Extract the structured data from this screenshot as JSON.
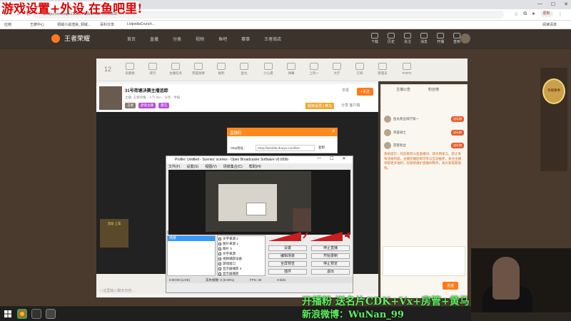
{
  "overlay": {
    "title": "游戏设置+外设,在鱼吧里!",
    "promo_line1": "开播粉 送名片CDK+Vx+房管+黄马",
    "promo_line2": "新浪微博：WuNan_99"
  },
  "browser": {
    "url": "douyu.com/topic/2019YNWE?rid=5396328",
    "profile_label": "更新",
    "bookmarks": [
      "应用",
      "王牌中心",
      "领域小说渲染_领域...",
      "百科分享",
      "LolpediaCrunch..."
    ],
    "bookmarks_right": "阅读清单"
  },
  "site": {
    "logo_text": "王者荣耀",
    "nav": [
      "首页",
      "直播",
      "分类",
      "视频",
      "鱼吧",
      "赛事",
      "王者商店"
    ],
    "right_icons": [
      "下载",
      "历史",
      "关注",
      "消息",
      "开播",
      "签到"
    ]
  },
  "room": {
    "fans_count": "12",
    "toolbar_items": [
      "贡献榜",
      "排行",
      "主播任务",
      "荣誉勋章",
      "福利",
      "鱼丸",
      "小心愿",
      "弹幕",
      "上热一",
      "大厅",
      "订阅",
      "管理员",
      "POPO"
    ],
    "name": "31号荷塘决赛主播追踪",
    "meta": "主播: 王者荣耀  ·  人气 99+  ·  分享  ·  举报",
    "tags": [
      "王者",
      "颜值主播",
      "黄马"
    ],
    "follow_label": "+关注",
    "report_label": "举报",
    "vip_label": "超级会员 | 黄马",
    "share_label": "分享  客户端",
    "comment_placeholder": "□ 这里输入聊天内容..."
  },
  "sidebar": {
    "tab1": "主播公告",
    "tab2": "粉丝榜",
    "rows": [
      {
        "name": "鱼丸粉丝排行第一",
        "chip": "送礼物"
      },
      {
        "name": "荣誉骑士",
        "chip": "送礼物"
      },
      {
        "name": "游客粉丝",
        "chip": "送礼物"
      }
    ],
    "chat_text": "系统提示：欢迎来到斗鱼直播间，请文明发言，禁止发布违规内容。主播开播后即可参与互动抽奖，关注主播领取更多福利，房管将维护直播间秩序，祝大家观看愉快。",
    "send_label": "发送"
  },
  "ads": {
    "badge_text": "荣耀赛事",
    "promo_text": "活动 上车"
  },
  "stream_dialog": {
    "title": "直播码",
    "rtmp_label": "rtmp地址：",
    "rtmp_value": "rtmp://send3a.douyu.com/live",
    "copy_label": "复制",
    "close": "✕"
  },
  "obs": {
    "title": "Profile: Untitled - Scenes: scenes - Open Broadcaster Software v0.659b",
    "menu": [
      "文件(F)",
      "设置(S)",
      "视图(V)",
      "场景集合(C)",
      "帮助(H)"
    ],
    "scenes_label": "场景:",
    "scenes": [
      "场景"
    ],
    "sources_label": "来源:",
    "sources": [
      "文字来源 2",
      "图片来源 1",
      "图片 3",
      "文字来源",
      "视频捕获设备",
      "游戏窗口",
      "显示器捕获 4",
      "显示器捕获"
    ],
    "buttons": [
      "设置",
      "停止直播",
      "编辑场景",
      "开始录制",
      "全屏预览",
      "停止预览",
      "插件",
      "退出"
    ],
    "status": [
      "0:00:00 (LIVE)",
      "丢失帧数: 0 (0.00%)",
      "FPS: 30",
      "0 kb/s"
    ],
    "window_controls": [
      "—",
      "☐",
      "✕"
    ]
  },
  "colors": {
    "accent": "#ff7a1a",
    "obs_selection": "#3399ff",
    "overlay_red": "#e00000",
    "overlay_green": "#5ff05f"
  }
}
